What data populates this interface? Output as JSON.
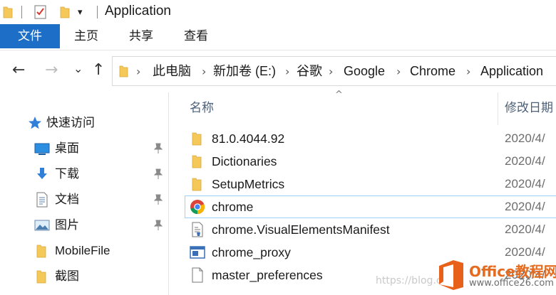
{
  "window": {
    "title": "Application"
  },
  "ribbon": {
    "tabs": [
      {
        "label": "文件",
        "active": true
      },
      {
        "label": "主页"
      },
      {
        "label": "共享"
      },
      {
        "label": "查看"
      }
    ]
  },
  "address": {
    "breadcrumbs": [
      "此电脑",
      "新加卷 (E:)",
      "谷歌",
      "Google",
      "Chrome",
      "Application"
    ],
    "separator": "›"
  },
  "nav_buttons": {
    "back": "←",
    "forward": "→",
    "recent": "⌄",
    "up": "↑"
  },
  "navpane": {
    "items": [
      {
        "label": "快速访问",
        "icon": "star-icon",
        "pinned": false
      },
      {
        "label": "桌面",
        "icon": "desktop-icon",
        "pinned": true
      },
      {
        "label": "下载",
        "icon": "download-icon",
        "pinned": true
      },
      {
        "label": "文档",
        "icon": "document-icon",
        "pinned": true
      },
      {
        "label": "图片",
        "icon": "picture-icon",
        "pinned": true
      },
      {
        "label": "MobileFile",
        "icon": "folder-icon",
        "pinned": false
      },
      {
        "label": "截图",
        "icon": "folder-icon",
        "pinned": false
      }
    ]
  },
  "filelist": {
    "columns": {
      "name": "名称",
      "modified": "修改日期"
    },
    "sort_indicator": "^",
    "rows": [
      {
        "name": "81.0.4044.92",
        "icon": "folder-icon",
        "date": "2020/4/"
      },
      {
        "name": "Dictionaries",
        "icon": "folder-icon",
        "date": "2020/4/"
      },
      {
        "name": "SetupMetrics",
        "icon": "folder-icon",
        "date": "2020/4/"
      },
      {
        "name": "chrome",
        "icon": "chrome-icon",
        "date": "2020/4/",
        "selected": true
      },
      {
        "name": "chrome.VisualElementsManifest",
        "icon": "manifest-file-icon",
        "date": "2020/4/"
      },
      {
        "name": "chrome_proxy",
        "icon": "app-window-icon",
        "date": "2020/4/"
      },
      {
        "name": "master_preferences",
        "icon": "blank-file-icon",
        "date": "2020/4/"
      }
    ]
  },
  "watermark": {
    "url": "https://blog.c",
    "brand": "Office教程网",
    "site": "www.office26.com"
  },
  "colors": {
    "accent": "#1c6ec7",
    "folder": "#f5c85a",
    "selection_border": "#99d1ff"
  }
}
